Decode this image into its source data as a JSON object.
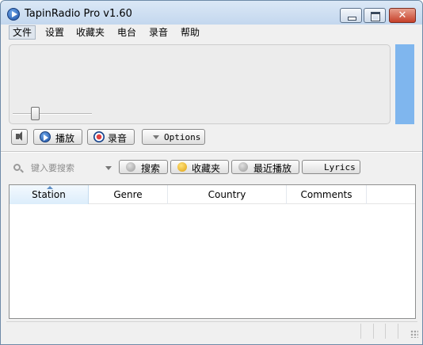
{
  "window": {
    "title": "TapinRadio Pro v1.60",
    "close_glyph": "✕"
  },
  "menu": {
    "items": [
      "文件",
      "设置",
      "收藏夹",
      "电台",
      "录音",
      "帮助"
    ]
  },
  "player": {
    "play_label": "播放",
    "record_label": "录音",
    "options_label": "Options"
  },
  "search": {
    "placeholder": "键入要搜索",
    "find_label": "搜索",
    "favorites_label": "收藏夹",
    "recent_label": "最近播放",
    "lyrics_label": "Lyrics"
  },
  "table": {
    "columns": [
      "Station",
      "Genre",
      "Country",
      "Comments"
    ],
    "sorted_column": "Station",
    "rows": []
  },
  "colors": {
    "level_meter": "#7fb6ee",
    "accent": "#1d4fa3"
  }
}
